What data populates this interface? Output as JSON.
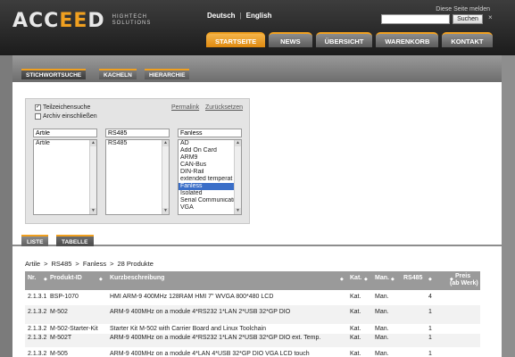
{
  "header": {
    "logo_text": "ACCEED",
    "logo_tagline": "HIGHTECH SOLUTIONS",
    "lang_de": "Deutsch",
    "lang_sep": "|",
    "lang_en": "English",
    "report_link": "Diese Seite melden",
    "search_placeholder": "",
    "search_button": "Suchen",
    "close": "×"
  },
  "nav": {
    "tabs": [
      {
        "label": "STARTSEITE",
        "active": true
      },
      {
        "label": "NEWS",
        "active": false
      },
      {
        "label": "ÜBERSICHT",
        "active": false
      },
      {
        "label": "WARENKORB",
        "active": false
      },
      {
        "label": "KONTAKT",
        "active": false
      }
    ]
  },
  "subtabs": [
    "STICHWORTSUCHE",
    "KACHELN",
    "HIERARCHIE"
  ],
  "filter": {
    "opt_partial": "Teilzeichensuche",
    "opt_archive": "Archiv einschließen",
    "permalink": "Permalink",
    "reset": "Zurücksetzen",
    "col1": {
      "value": "Artile",
      "items": [
        "Artile"
      ]
    },
    "col2": {
      "value": "RS485",
      "items": [
        "RS485"
      ]
    },
    "col3": {
      "value": "Fanless",
      "items": [
        "AD",
        "Add On Card",
        "ARM9",
        "CAN-Bus",
        "DIN-Rail",
        "extended temperat",
        "Fanless",
        "Isolated",
        "Serial Communicati",
        "VGA"
      ],
      "selected": "Fanless"
    }
  },
  "view_tabs": [
    "LISTE",
    "TABELLE"
  ],
  "breadcrumb": [
    "Artile",
    ">",
    "RS485",
    ">",
    "Fanless",
    ">",
    "28 Produkte"
  ],
  "table": {
    "headers": {
      "nr": "Nr.",
      "produkt_id": "Produkt-ID",
      "kurz": "Kurzbeschreibung",
      "kat": "Kat.",
      "man": "Man.",
      "rs485": "RS485",
      "preis": "Preis",
      "preis_sub": "(ab Werk)"
    },
    "rows": [
      {
        "nr": "2.1.3.1",
        "id": "BSP-1070",
        "desc": "HMI ARM-9 400MHz 128RAM HMI 7\" WVGA 800*480 LCD",
        "kat": "Kat.",
        "man": "Man.",
        "rs485": "4"
      },
      {
        "nr": "2.1.3.2",
        "id": "M-502",
        "desc": "ARM-9 400MHz on a module 4*RS232 1*LAN 2*USB 32*GP DIO",
        "kat": "Kat.",
        "man": "Man.",
        "rs485": "1"
      },
      {
        "nr": "2.1.3.2",
        "id": "M-502-Starter-Kit",
        "desc": "Starter Kit M-502 with Carrier Board and Linux Toolchain",
        "kat": "Kat.",
        "man": "Man.",
        "rs485": "1"
      },
      {
        "nr": "2.1.3.2",
        "id": "M-502T",
        "desc": "ARM-9 400MHz on a module 4*RS232 1*LAN 2*USB 32*GP DIO ext. Temp.",
        "kat": "Kat.",
        "man": "Man.",
        "rs485": "1"
      },
      {
        "nr": "2.1.3.2",
        "id": "M-505",
        "desc": "ARM-9 400MHz on a module 4*LAN 4*USB 32*GP DIO VGA LCD touch",
        "kat": "Kat.",
        "man": "Man.",
        "rs485": "1"
      }
    ]
  },
  "colors": {
    "accent": "#f0a020",
    "header_bg": "#262626",
    "table_head": "#9a9a9a"
  }
}
